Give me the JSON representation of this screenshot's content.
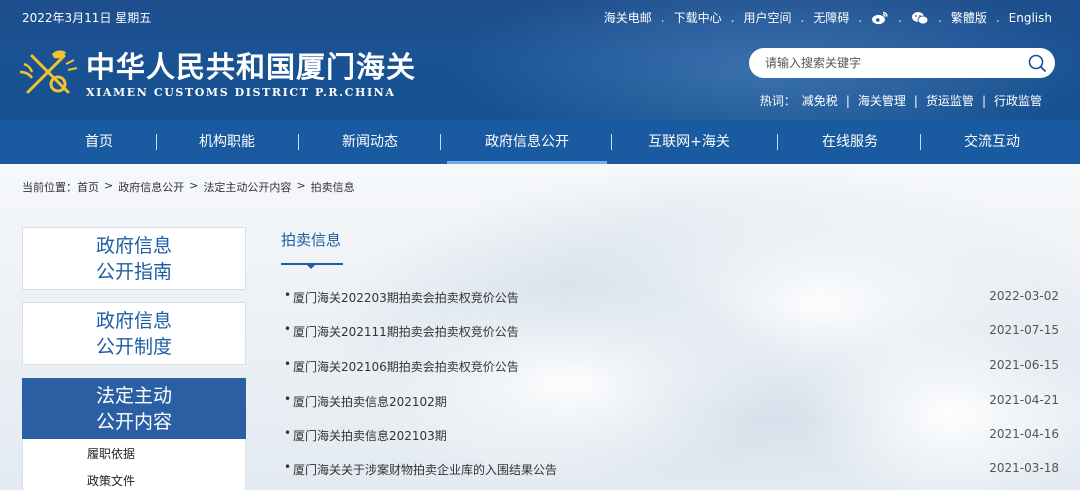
{
  "header": {
    "date": "2022年3月11日 星期五",
    "top_links": [
      "海关电邮",
      "下载中心",
      "用户空间",
      "无障碍"
    ],
    "top_icons": [
      "weibo-icon",
      "wechat-icon"
    ],
    "lang_links": [
      "繁體版",
      "English"
    ],
    "site_name": "中华人民共和国厦门海关",
    "site_name_en": "XIAMEN CUSTOMS DISTRICT P.R.CHINA",
    "search_placeholder": "请输入搜索关键字",
    "hot_label": "热词：",
    "hot_words": [
      "减免税",
      "海关管理",
      "货运监管",
      "行政监管"
    ]
  },
  "nav": {
    "items": [
      "首页",
      "机构职能",
      "新闻动态",
      "政府信息公开",
      "互联网+海关",
      "在线服务",
      "交流互动"
    ],
    "active": "政府信息公开"
  },
  "breadcrumb": {
    "prefix": "当前位置：",
    "items": [
      "首页",
      "政府信息公开",
      "法定主动公开内容",
      "拍卖信息"
    ]
  },
  "sidebar": {
    "cards": [
      {
        "line1": "政府信息",
        "line2": "公开指南"
      },
      {
        "line1": "政府信息",
        "line2": "公开制度"
      }
    ],
    "active": {
      "line1": "法定主动",
      "line2": "公开内容"
    },
    "sub_items": [
      "履职依据",
      "政策文件"
    ]
  },
  "main": {
    "section_title": "拍卖信息",
    "bullet": "•",
    "items": [
      {
        "title": "厦门海关202203期拍卖会拍卖权竞价公告",
        "date": "2022-03-02"
      },
      {
        "title": "厦门海关202111期拍卖会拍卖权竞价公告",
        "date": "2021-07-15"
      },
      {
        "title": "厦门海关202106期拍卖会拍卖权竞价公告",
        "date": "2021-06-15"
      },
      {
        "title": "厦门海关拍卖信息202102期",
        "date": "2021-04-21"
      },
      {
        "title": "厦门海关拍卖信息202103期",
        "date": "2021-04-16"
      },
      {
        "title": "厦门海关关于涉案财物拍卖企业库的入围结果公告",
        "date": "2021-03-18"
      }
    ]
  },
  "colors": {
    "header_blue": "#1a5294",
    "nav_blue": "#1a5aa0",
    "accent_blue": "#1d5da4",
    "sidebar_active": "#2a5fa3"
  }
}
